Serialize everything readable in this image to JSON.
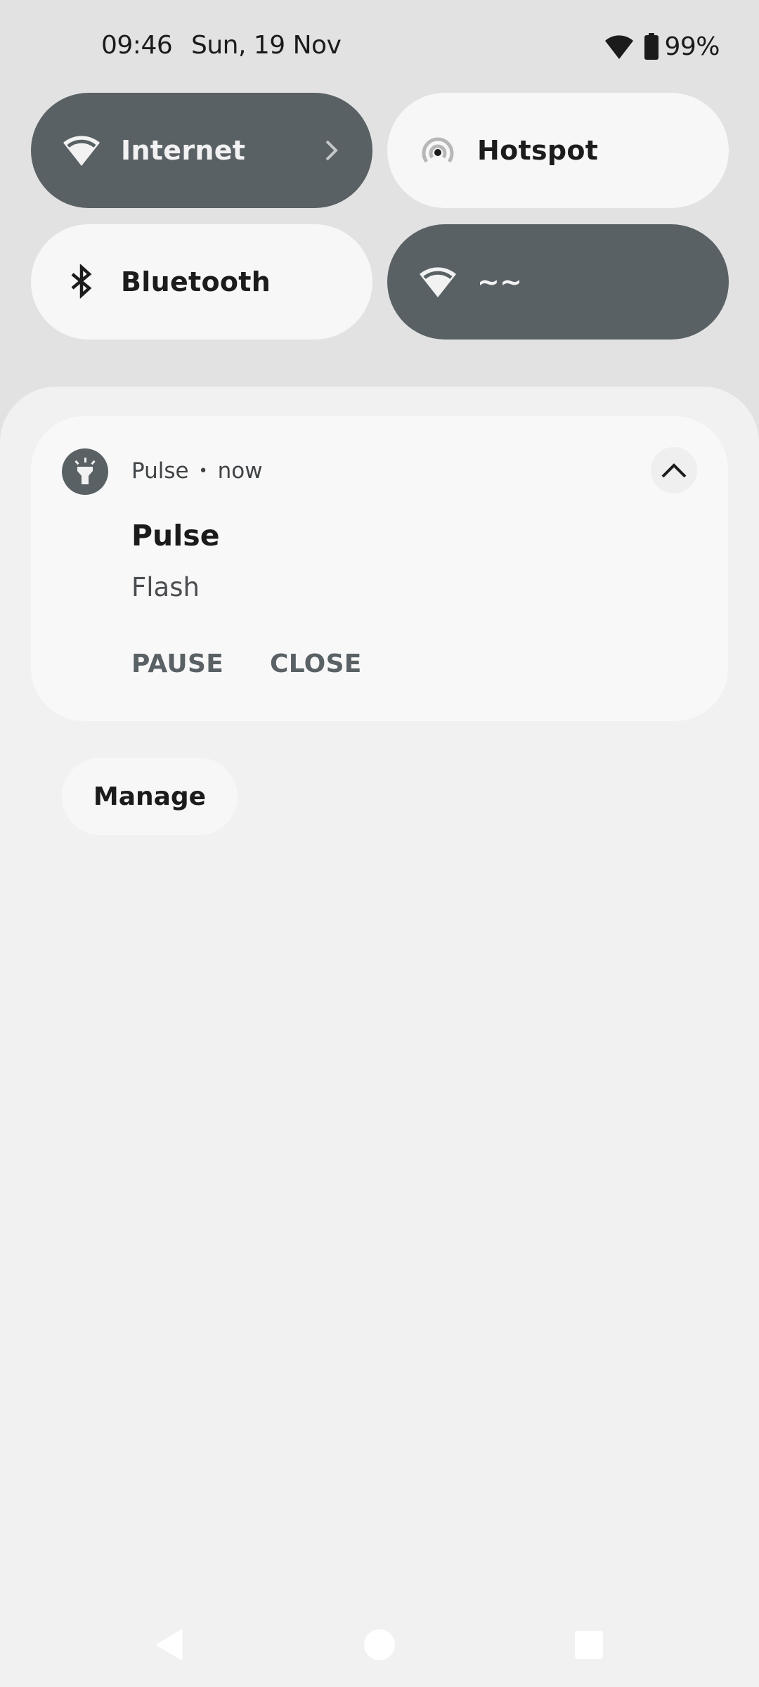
{
  "status_bar": {
    "time": "09:46",
    "date": "Sun, 19 Nov",
    "wifi_icon": "wifi-icon",
    "battery_icon": "battery-icon",
    "battery_percent": "99%"
  },
  "quick_settings": {
    "tiles": [
      {
        "label": "Internet",
        "icon": "wifi-icon",
        "state": "active",
        "has_chevron": true
      },
      {
        "label": "Hotspot",
        "icon": "hotspot-icon",
        "state": "inactive"
      },
      {
        "label": "Bluetooth",
        "icon": "bluetooth-icon",
        "state": "inactive"
      },
      {
        "label": "~~",
        "icon": "wifi-icon",
        "state": "active"
      }
    ]
  },
  "notification": {
    "app_icon": "flashlight-icon",
    "app_name": "Pulse",
    "separator": "•",
    "time": "now",
    "title": "Pulse",
    "text": "Flash",
    "collapse_icon": "chevron-up-icon",
    "actions": [
      {
        "label": "PAUSE"
      },
      {
        "label": "CLOSE"
      }
    ]
  },
  "manage_button": {
    "label": "Manage"
  },
  "navigation_bar": {
    "back": "back-icon",
    "home": "home-icon",
    "recents": "recents-icon"
  },
  "colors": {
    "active_tile": "#596165",
    "inactive_tile": "#f8f7f7",
    "shade_background": "#e2e2e2",
    "panel_background": "#f1f1f1",
    "card_background": "#f9f8f8",
    "action_text": "#596165"
  }
}
